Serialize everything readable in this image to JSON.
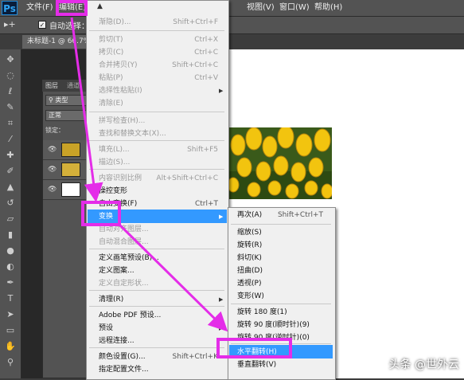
{
  "app": {
    "logo": "Ps"
  },
  "menubar": {
    "file": "文件(F)",
    "edit": "编辑(E)",
    "view": "视图(V)",
    "window": "窗口(W)",
    "help": "帮助(H)"
  },
  "options": {
    "auto_select_label": "自动选择："
  },
  "doc_tab": {
    "label": "未标题-1 @ 66.7%"
  },
  "layers_panel": {
    "tab1": "图层",
    "tab2": "通道",
    "kind": "类型",
    "mode": "正常",
    "lock": "锁定："
  },
  "edit_menu": {
    "items": [
      {
        "label": "渐隐(D)...",
        "shortcut": "Shift+Ctrl+F",
        "disabled": true
      },
      {
        "label": "剪切(T)",
        "shortcut": "Ctrl+X",
        "disabled": true
      },
      {
        "label": "拷贝(C)",
        "shortcut": "Ctrl+C",
        "disabled": true
      },
      {
        "label": "合并拷贝(Y)",
        "shortcut": "Shift+Ctrl+C",
        "disabled": true
      },
      {
        "label": "粘贴(P)",
        "shortcut": "Ctrl+V",
        "disabled": true
      },
      {
        "label": "选择性粘贴(I)",
        "shortcut": "",
        "disabled": true
      },
      {
        "label": "清除(E)",
        "shortcut": "",
        "disabled": true
      },
      {
        "label": "拼写检查(H)...",
        "shortcut": "",
        "disabled": true
      },
      {
        "label": "查找和替换文本(X)...",
        "shortcut": "",
        "disabled": true
      },
      {
        "label": "填充(L)...",
        "shortcut": "Shift+F5",
        "disabled": true
      },
      {
        "label": "描边(S)...",
        "shortcut": "",
        "disabled": true
      },
      {
        "label": "内容识别比例",
        "shortcut": "Alt+Shift+Ctrl+C",
        "disabled": true
      },
      {
        "label": "操控变形",
        "shortcut": "",
        "disabled": false
      },
      {
        "label": "自由变换(F)",
        "shortcut": "Ctrl+T",
        "disabled": false
      },
      {
        "label": "变换",
        "shortcut": "",
        "disabled": false
      },
      {
        "label": "自动对齐图层...",
        "shortcut": "",
        "disabled": true
      },
      {
        "label": "自动混合图层...",
        "shortcut": "",
        "disabled": true
      },
      {
        "label": "定义画笔预设(B)...",
        "shortcut": "",
        "disabled": false
      },
      {
        "label": "定义图案...",
        "shortcut": "",
        "disabled": false
      },
      {
        "label": "定义自定形状...",
        "shortcut": "",
        "disabled": true
      },
      {
        "label": "清理(R)",
        "shortcut": "",
        "disabled": false
      },
      {
        "label": "Adobe PDF 预设...",
        "shortcut": "",
        "disabled": false
      },
      {
        "label": "预设",
        "shortcut": "",
        "disabled": false
      },
      {
        "label": "远程连接...",
        "shortcut": "",
        "disabled": false
      },
      {
        "label": "颜色设置(G)...",
        "shortcut": "Shift+Ctrl+K",
        "disabled": false
      },
      {
        "label": "指定配置文件...",
        "shortcut": "",
        "disabled": false
      }
    ]
  },
  "transform_menu": {
    "items": [
      {
        "label": "再次(A)",
        "shortcut": "Shift+Ctrl+T"
      },
      {
        "label": "缩放(S)",
        "shortcut": ""
      },
      {
        "label": "旋转(R)",
        "shortcut": ""
      },
      {
        "label": "斜切(K)",
        "shortcut": ""
      },
      {
        "label": "扭曲(D)",
        "shortcut": ""
      },
      {
        "label": "透视(P)",
        "shortcut": ""
      },
      {
        "label": "变形(W)",
        "shortcut": ""
      },
      {
        "label": "旋转 180 度(1)",
        "shortcut": ""
      },
      {
        "label": "旋转 90 度(顺时针)(9)",
        "shortcut": ""
      },
      {
        "label": "旋转 90 度(逆时针)(0)",
        "shortcut": ""
      },
      {
        "label": "水平翻转(H)",
        "shortcut": ""
      },
      {
        "label": "垂直翻转(V)",
        "shortcut": ""
      }
    ]
  },
  "watermark": "头条 @世外云",
  "colors": {
    "highlight": "#e42de8",
    "selected": "#3399ff",
    "menu_bg": "#f0f0f0"
  }
}
